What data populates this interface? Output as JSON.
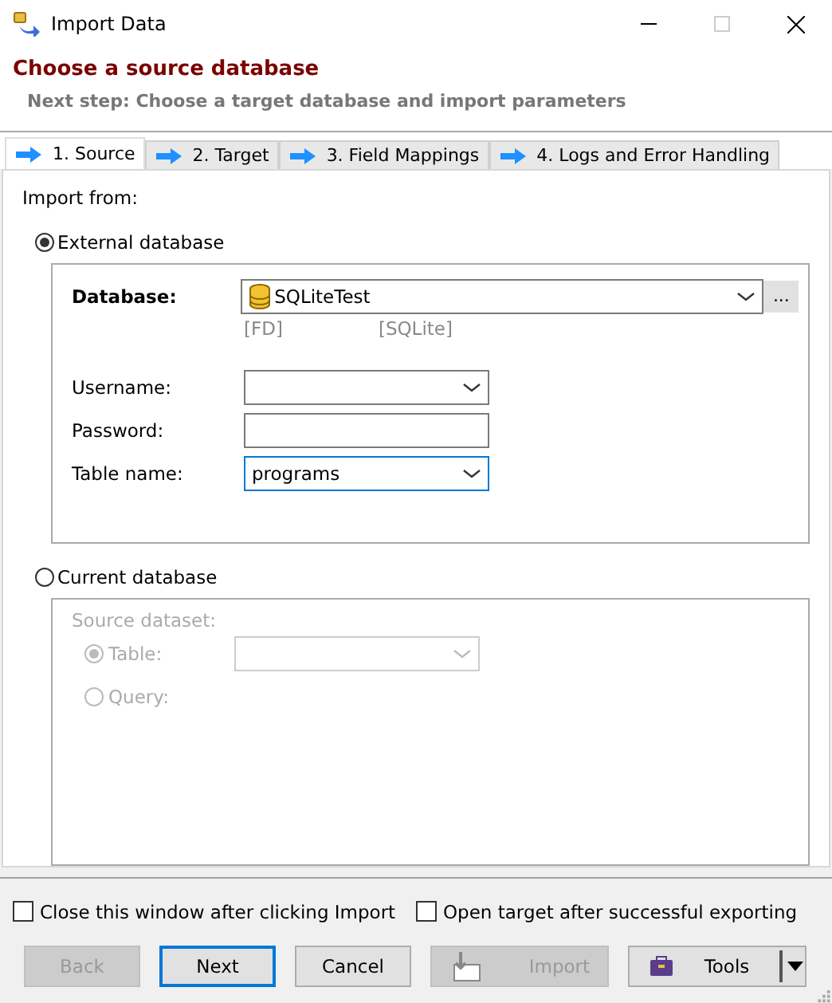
{
  "window": {
    "title": "Import Data"
  },
  "header": {
    "title": "Choose a source database",
    "subtitle": "Next step: Choose a target database and import parameters"
  },
  "tabs": [
    {
      "label": "1. Source",
      "selected": true
    },
    {
      "label": "2. Target",
      "selected": false
    },
    {
      "label": "3. Field Mappings",
      "selected": false
    },
    {
      "label": "4. Logs and Error Handling",
      "selected": false
    }
  ],
  "import_from_label": "Import from:",
  "sources": [
    {
      "label": "External database",
      "selected": true
    },
    {
      "label": "Current database",
      "selected": false
    }
  ],
  "external": {
    "database": {
      "label": "Database:",
      "value": "SQLiteTest",
      "button": "...",
      "tags": [
        "[FD]",
        "[SQLite]"
      ]
    },
    "fields": [
      {
        "kind": "combo",
        "label": "Username:",
        "focused": false
      },
      {
        "kind": "text",
        "label": "Password:",
        "focused": false
      },
      {
        "kind": "combo",
        "label": "Table name:",
        "value": "programs",
        "focused": true
      }
    ]
  },
  "current": {
    "disabled": true,
    "label": "Source dataset:",
    "options": [
      {
        "label": "Table:",
        "selected": true,
        "kind": "combo"
      },
      {
        "label": "Query:",
        "selected": false,
        "kind": "plain"
      }
    ]
  },
  "options": [
    {
      "label": "Close this window after clicking Import",
      "checked": false
    },
    {
      "label": "Open target after successful exporting",
      "checked": false
    }
  ],
  "buttons": [
    {
      "label": "Back",
      "kind": "plain",
      "disabled": true,
      "default": false
    },
    {
      "label": "Next",
      "kind": "plain",
      "disabled": false,
      "default": true
    },
    {
      "label": "Cancel",
      "kind": "plain",
      "disabled": false,
      "default": false
    },
    {
      "label": "Import",
      "kind": "import",
      "disabled": true,
      "default": false
    },
    {
      "label": "Tools",
      "kind": "tools",
      "disabled": false,
      "default": false
    }
  ]
}
